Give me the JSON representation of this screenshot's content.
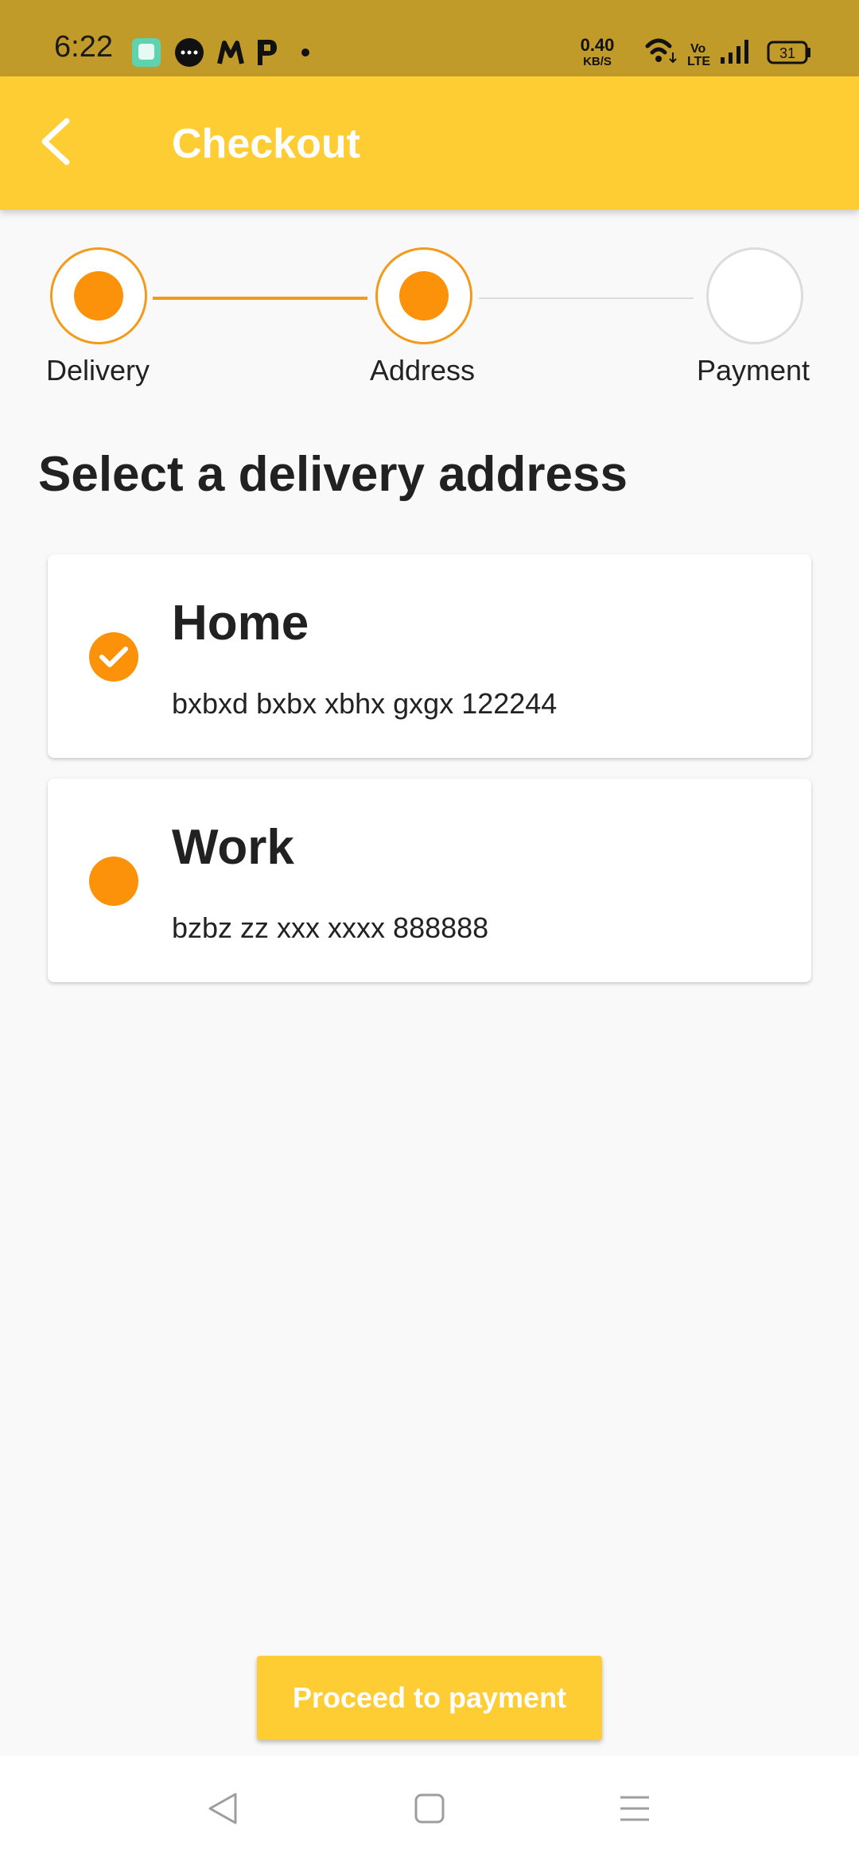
{
  "status_bar": {
    "time": "6:22",
    "net_speed_value": "0.40",
    "net_speed_unit": "KB/S",
    "volte_top": "Vo",
    "volte_bottom": "LTE",
    "battery_level": "31",
    "app_icons": [
      "gallery-app-icon",
      "messages-app-icon",
      "m-app-icon",
      "p-app-icon",
      "more-notifications-dot-icon"
    ],
    "bg_color": "#c19b2a"
  },
  "app_bar": {
    "title": "Checkout",
    "back_icon": "chevron-left-icon",
    "bg_color": "#fecd34"
  },
  "stepper": {
    "steps": [
      {
        "label": "Delivery",
        "state": "completed"
      },
      {
        "label": "Address",
        "state": "current"
      },
      {
        "label": "Payment",
        "state": "pending"
      }
    ],
    "accent_color": "#fb9209",
    "inactive_line_color": "#dcdcdc"
  },
  "main": {
    "title": "Select a delivery address",
    "addresses": [
      {
        "name": "Home",
        "line": "bxbxd bxbx xbhx gxgx 122244",
        "selected": true
      },
      {
        "name": "Work",
        "line": "bzbz zz xxx xxxx 888888",
        "selected": false
      }
    ]
  },
  "actions": {
    "proceed_label": "Proceed to payment"
  },
  "nav_bar": {
    "buttons": [
      "back-triangle-icon",
      "home-square-icon",
      "recents-menu-icon"
    ]
  }
}
